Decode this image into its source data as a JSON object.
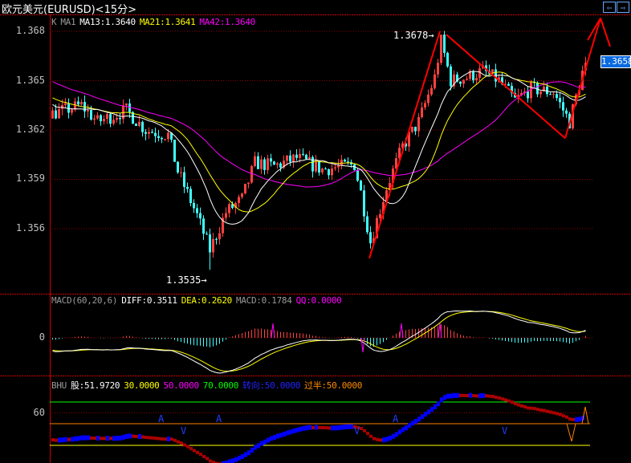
{
  "window": {
    "title": "欧元美元(EURUSD)<15分>",
    "nav_prev": "⇦",
    "nav_next": "⇨"
  },
  "main_legend": {
    "k": "K",
    "ma1": "MA1",
    "ma13": "MA13:1.3640",
    "ma21": "MA21:1.3641",
    "ma42": "MA42:1.3640"
  },
  "macd_legend": {
    "name": "MACD(60,20,6)",
    "diff": "DIFF:0.3511",
    "dea": "DEA:0.2620",
    "macd": "MACD:0.1784",
    "qq": "QQ:0.0000"
  },
  "bhu_legend": {
    "name": "BHU",
    "gu": "股:51.9720",
    "l30": "30.0000",
    "l50": "50.0000",
    "l70": "70.0000",
    "turn": "转向:50.0000",
    "half": "过半:50.0000"
  },
  "annotations": {
    "high": "1.3678→",
    "low": "1.3535→",
    "current_price": "1.3658"
  },
  "colors": {
    "up": "#ff4040",
    "down": "#40ffff",
    "ma13": "#ffffff",
    "ma21": "#ffff00",
    "ma42": "#ff00ff",
    "grid": "#8b0000",
    "trend": "#ff0000"
  },
  "chart_data": {
    "type": "candlestick",
    "price_axis": {
      "ticks": [
        "1.368",
        "1.365",
        "1.362",
        "1.359",
        "1.356"
      ],
      "range": [
        1.352,
        1.369
      ]
    },
    "macd_axis": {
      "ticks": [
        "0"
      ]
    },
    "bhu_axis": {
      "ticks": [
        "60"
      ],
      "levels": [
        70,
        50,
        30
      ],
      "range": [
        0,
        100
      ]
    },
    "bar_count": 167,
    "price_path": [
      [
        -45,
        1.367
      ],
      [
        -20,
        1.365
      ],
      [
        0,
        1.363
      ],
      [
        9,
        1.3635
      ],
      [
        14,
        1.3625
      ],
      [
        23,
        1.3632
      ],
      [
        29,
        1.362
      ],
      [
        36,
        1.3617
      ],
      [
        39,
        1.3595
      ],
      [
        45,
        1.3568
      ],
      [
        49,
        1.3547
      ],
      [
        54,
        1.357
      ],
      [
        59,
        1.3578
      ],
      [
        63,
        1.36
      ],
      [
        69,
        1.3598
      ],
      [
        76,
        1.3603
      ],
      [
        84,
        1.3596
      ],
      [
        94,
        1.3599
      ],
      [
        96,
        1.3582
      ],
      [
        99,
        1.3552
      ],
      [
        104,
        1.3585
      ],
      [
        109,
        1.361
      ],
      [
        114,
        1.3625
      ],
      [
        119,
        1.3652
      ],
      [
        121,
        1.3674
      ],
      [
        124,
        1.365
      ],
      [
        129,
        1.3652
      ],
      [
        134,
        1.3656
      ],
      [
        139,
        1.365
      ],
      [
        144,
        1.3638
      ],
      [
        149,
        1.3645
      ],
      [
        156,
        1.3643
      ],
      [
        161,
        1.3625
      ],
      [
        165,
        1.3655
      ],
      [
        166,
        1.3658
      ]
    ],
    "high": {
      "value": 1.3678,
      "index": 121
    },
    "low": {
      "value": 1.3535,
      "index": 49
    },
    "bhu_signals": [
      {
        "index": 34,
        "type": "A"
      },
      {
        "index": 41,
        "type": "V"
      },
      {
        "index": 52,
        "type": "A"
      },
      {
        "index": 95,
        "type": "V"
      },
      {
        "index": 107,
        "type": "A"
      },
      {
        "index": 141,
        "type": "V"
      }
    ],
    "trendlines": [
      [
        [
          99,
          1.3542
        ],
        [
          121,
          1.368
        ]
      ],
      [
        [
          123,
          1.3678
        ],
        [
          160,
          1.3615
        ]
      ],
      [
        [
          160,
          1.3615
        ],
        [
          171,
          1.3688
        ]
      ]
    ]
  }
}
